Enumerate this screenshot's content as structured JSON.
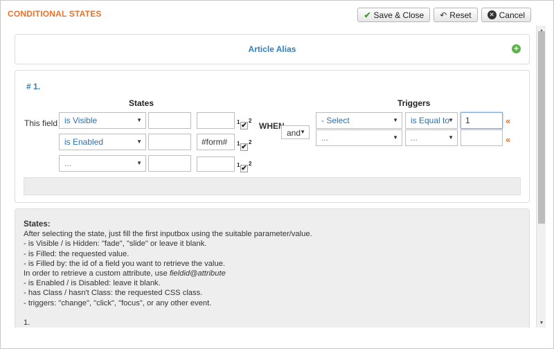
{
  "modal": {
    "title": "CONDITIONAL STATES"
  },
  "toolbar": {
    "save_close": "Save & Close",
    "reset": "Reset",
    "cancel": "Cancel"
  },
  "alias": {
    "title": "Article Alias"
  },
  "condition": {
    "number": "# 1.",
    "states_header": "States",
    "triggers_header": "Triggers",
    "this_field_label": "This field",
    "when_label": "WHEN",
    "logic_select": "and",
    "sup_label": "2",
    "sub_label": "1",
    "check_mark": "✔",
    "states_rows": [
      {
        "state": "is Visible",
        "value": "",
        "target": ""
      },
      {
        "state": "is Enabled",
        "value": "",
        "target": "#form#"
      },
      {
        "state": "...",
        "value": "",
        "target": ""
      }
    ],
    "trigger_rows": [
      {
        "field": "- Select",
        "operator": "is Equal to",
        "value": "1"
      },
      {
        "field": "...",
        "operator": "...",
        "value": ""
      }
    ],
    "remove_symbol": "«"
  },
  "help": {
    "heading": "States:",
    "lines": [
      "After selecting the state, just fill the first inputbox using the suitable parameter/value.",
      "- is Visible / is Hidden: \"fade\", \"slide\" or leave it blank.",
      "- is Filled: the requested value.",
      "- is Filled by: the id of a field you want to retrieve the value.",
      "In order to retrieve a custom attribute, use ",
      "fieldid@attribute",
      "- is Enabled / is Disabled: leave it blank.",
      "- has Class / hasn't Class: the requested CSS class.",
      "- triggers: \"change\", \"click\", \"focus\", or any other event."
    ],
    "footnote": "1."
  },
  "icons": {
    "check": "check-icon",
    "reset": "reset-icon",
    "cancel": "cancel-icon",
    "add": "plus-circle-icon",
    "arrow": "chevron-down-icon"
  },
  "colors": {
    "accent_orange": "#e8732a",
    "link_blue": "#2f7fbe",
    "add_green": "#5cb34a"
  }
}
